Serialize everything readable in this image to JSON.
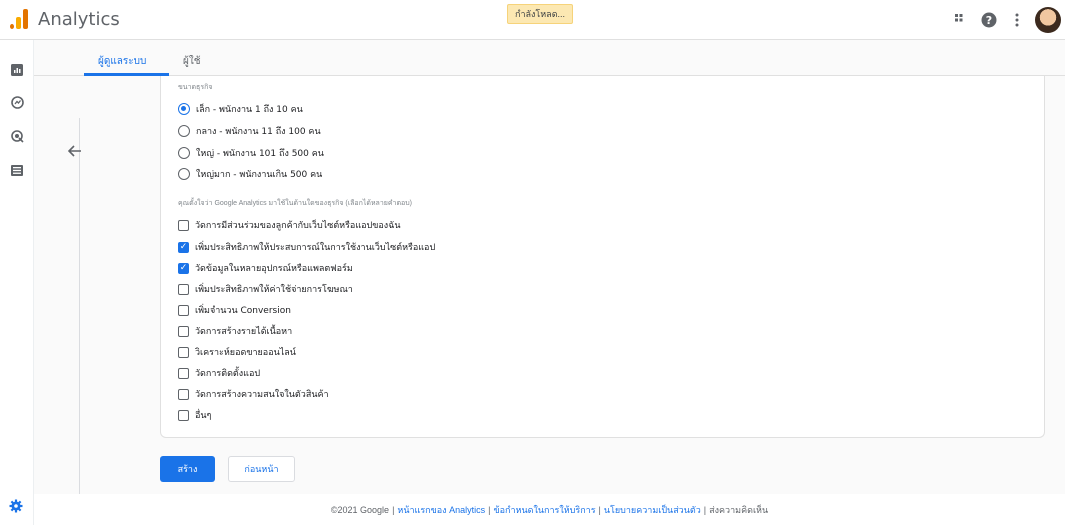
{
  "app": {
    "title": "Analytics",
    "loading": "กำลังโหลด..."
  },
  "tabs": [
    {
      "label": "ผู้ดูแลระบบ"
    },
    {
      "label": "ผู้ใช้"
    }
  ],
  "form": {
    "size_label": "ขนาดธุรกิจ",
    "size_options": [
      {
        "label": "เล็ก - พนักงาน 1 ถึง 10 คน",
        "selected": true
      },
      {
        "label": "กลาง - พนักงาน 11 ถึง 100 คน",
        "selected": false
      },
      {
        "label": "ใหญ่ - พนักงาน 101 ถึง 500 คน",
        "selected": false
      },
      {
        "label": "ใหญ่มาก - พนักงานเกิน 500 คน",
        "selected": false
      }
    ],
    "usage_label": "คุณตั้งใจว่า Google Analytics มาใช้ในด้านใดของธุรกิจ (เลือกได้หลายคำตอบ)",
    "usage_options": [
      {
        "label": "วัดการมีส่วนร่วมของลูกค้ากับเว็บไซต์หรือแอปของฉัน",
        "checked": false
      },
      {
        "label": "เพิ่มประสิทธิภาพให้ประสบการณ์ในการใช้งานเว็บไซต์หรือแอป",
        "checked": true
      },
      {
        "label": "วัดข้อมูลในหลายอุปกรณ์หรือแพลตฟอร์ม",
        "checked": true
      },
      {
        "label": "เพิ่มประสิทธิภาพให้ค่าใช้จ่ายการโฆษณา",
        "checked": false
      },
      {
        "label": "เพิ่มจำนวน Conversion",
        "checked": false
      },
      {
        "label": "วัดการสร้างรายได้เนื้อหา",
        "checked": false
      },
      {
        "label": "วิเคราะห์ยอดขายออนไลน์",
        "checked": false
      },
      {
        "label": "วัดการติดตั้งแอป",
        "checked": false
      },
      {
        "label": "วัดการสร้างความสนใจในตัวสินค้า",
        "checked": false
      },
      {
        "label": "อื่นๆ",
        "checked": false
      }
    ]
  },
  "buttons": {
    "create": "สร้าง",
    "previous": "ก่อนหน้า"
  },
  "footer": {
    "copyright": "©2021 Google",
    "links": [
      "หน้าแรกของ Analytics",
      "ข้อกำหนดในการให้บริการ",
      "นโยบายความเป็นส่วนตัว"
    ],
    "feedback": "ส่งความคิดเห็น"
  },
  "icons": {
    "apps": "apps-grid-icon",
    "help": "help-icon",
    "more": "more-vert-icon"
  },
  "colors": {
    "accent": "#1a73e8",
    "logo_orange": "#e37400",
    "logo_yellow": "#f9ab00"
  }
}
